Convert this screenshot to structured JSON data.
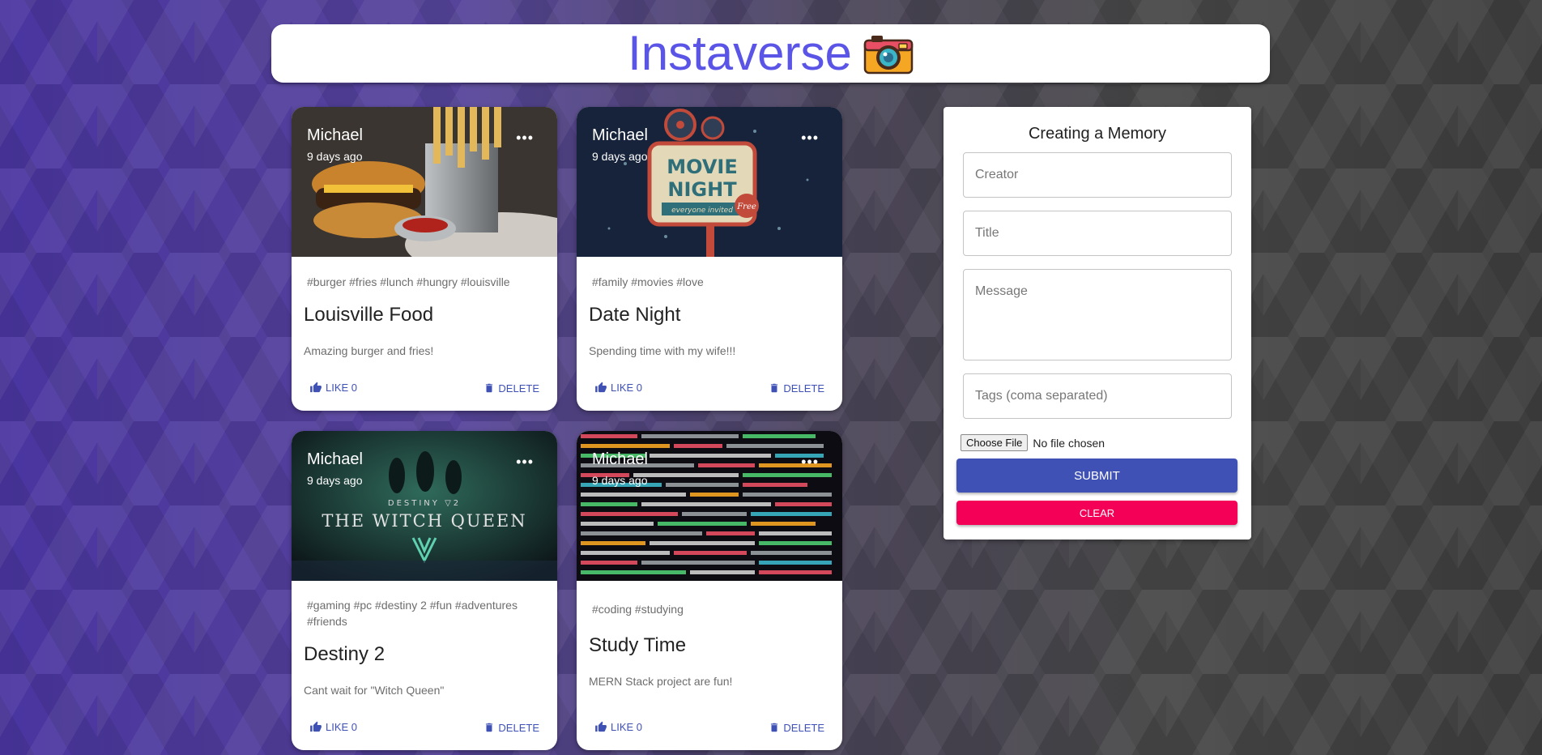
{
  "app": {
    "title": "Instaverse",
    "logo_icon": "camera-icon"
  },
  "posts": [
    {
      "creator": "Michael",
      "time": "9 days ago",
      "tags": "#burger #fries #lunch #hungry #louisville",
      "title": "Louisville Food",
      "message": "Amazing burger and fries!",
      "like_label": "LIKE 0",
      "delete_label": "DELETE",
      "image": "burger-and-fries-photo"
    },
    {
      "creator": "Michael",
      "time": "9 days ago",
      "tags": "#family #movies #love",
      "title": "Date Night",
      "message": "Spending time with my wife!!!",
      "like_label": "LIKE 0",
      "delete_label": "DELETE",
      "image": "movie-night-sign-illustration",
      "image_text": {
        "line1": "MOVIE",
        "line2": "NIGHT",
        "line3": "everyone invited",
        "badge": "Free"
      }
    },
    {
      "creator": "Michael",
      "time": "9 days ago",
      "tags": "#gaming #pc #destiny 2 #fun #adventures #friends",
      "title": "Destiny 2",
      "message": "Cant wait for \"Witch Queen\"",
      "like_label": "LIKE 0",
      "delete_label": "DELETE",
      "image": "witch-queen-game-art",
      "image_text": {
        "line1": "DESTINY ▽2",
        "line2": "THE WITCH QUEEN"
      }
    },
    {
      "creator": "Michael",
      "time": "9 days ago",
      "tags": "#coding #studying",
      "title": "Study Time",
      "message": "MERN Stack project are fun!",
      "like_label": "LIKE 0",
      "delete_label": "DELETE",
      "image": "code-screen-photo"
    }
  ],
  "form": {
    "title": "Creating a Memory",
    "creator_placeholder": "Creator",
    "title_placeholder": "Title",
    "message_placeholder": "Message",
    "tags_placeholder": "Tags (coma separated)",
    "file_button": "Choose File",
    "file_status": "No file chosen",
    "submit_label": "SUBMIT",
    "clear_label": "CLEAR"
  },
  "colors": {
    "brand": "#5a55e6",
    "primary": "#3f51b5",
    "secondary": "#f50057"
  }
}
